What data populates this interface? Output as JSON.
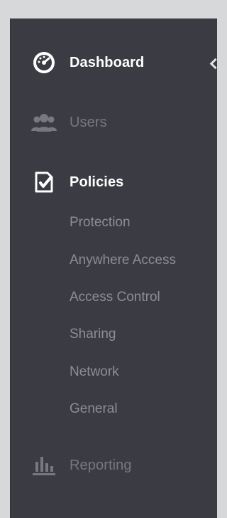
{
  "nav": {
    "dashboard": {
      "label": "Dashboard",
      "icon": "dashboard-gauge-icon"
    },
    "users": {
      "label": "Users",
      "icon": "users-icon"
    },
    "policies": {
      "label": "Policies",
      "icon": "policy-checklist-icon",
      "items": [
        {
          "label": "Protection"
        },
        {
          "label": "Anywhere Access"
        },
        {
          "label": "Access Control"
        },
        {
          "label": "Sharing"
        },
        {
          "label": "Network"
        },
        {
          "label": "General"
        }
      ]
    },
    "reporting": {
      "label": "Reporting",
      "icon": "bar-chart-icon"
    }
  },
  "colors": {
    "sidebar_bg": "#3b3b43",
    "page_bg": "#d7d8da",
    "active_text": "#ffffff",
    "muted_text": "#777882",
    "subitem_text": "#8c8d96"
  }
}
